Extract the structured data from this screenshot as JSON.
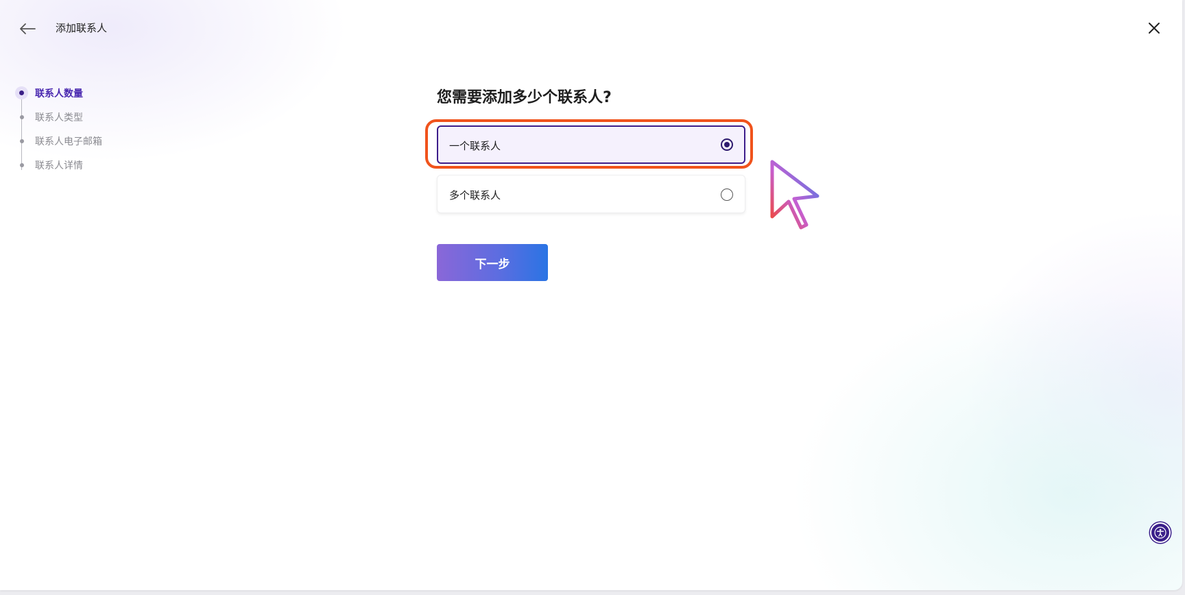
{
  "header": {
    "title": "添加联系人",
    "back_icon": "arrow-left-icon",
    "close_icon": "close-icon"
  },
  "steps": [
    {
      "label": "联系人数量",
      "active": true
    },
    {
      "label": "联系人类型",
      "active": false
    },
    {
      "label": "联系人电子邮箱",
      "active": false
    },
    {
      "label": "联系人详情",
      "active": false
    }
  ],
  "main": {
    "question": "您需要添加多少个联系人?",
    "options": [
      {
        "label": "一个联系人",
        "selected": true
      },
      {
        "label": "多个联系人",
        "selected": false
      }
    ],
    "next_label": "下一步"
  },
  "colors": {
    "accent": "#3d1d8a",
    "highlight": "#f0531c",
    "button_start": "#8a67d8",
    "button_end": "#2a74e4"
  },
  "accessibility_icon": "accessibility-icon"
}
